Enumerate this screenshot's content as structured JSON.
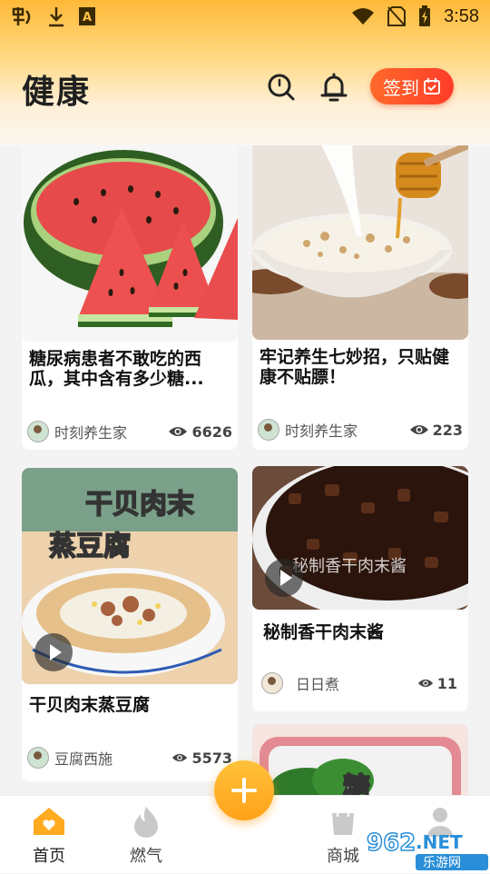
{
  "status_bar": {
    "time": "3:58",
    "left_icons": [
      "app-notification-icon",
      "download-icon",
      "a-box-icon"
    ],
    "right_icons": [
      "wifi-icon",
      "no-sim-icon",
      "battery-charging-icon"
    ]
  },
  "header": {
    "title": "健康",
    "search_icon": "search-icon",
    "bell_icon": "bell-icon",
    "signin_label": "签到"
  },
  "feed": {
    "cards": [
      {
        "title": "糖尿病患者不敢吃的西瓜，其中含有多少糖...",
        "author": "时刻养生家",
        "views": "6626",
        "has_video": false
      },
      {
        "title": "牢记养生七妙招，只贴健康不贴膘！",
        "author": "时刻养生家",
        "views": "223",
        "has_video": false
      },
      {
        "title": "干贝肉末蒸豆腐",
        "author": "豆腐西施",
        "views": "5573",
        "has_video": true,
        "overlay_text": [
          "干贝肉末",
          "蒸豆腐"
        ]
      },
      {
        "title": "秘制香干肉末酱",
        "author": "日日煮",
        "views": "11",
        "has_video": true,
        "overlay_text": [
          "秘制香干肉末酱"
        ]
      },
      {
        "overlay_text": [
          "糖"
        ]
      }
    ]
  },
  "bottom_nav": {
    "items": [
      {
        "label": "首页",
        "icon": "home-icon",
        "active": true
      },
      {
        "label": "燃气",
        "icon": "flame-icon",
        "active": false
      },
      {
        "label": "商城",
        "icon": "shopping-bag-icon",
        "active": false
      },
      {
        "label": "",
        "icon": "profile-icon",
        "active": false
      }
    ],
    "fab_icon": "plus-icon"
  },
  "watermark": {
    "text1": "962",
    "text2": ".NET",
    "text3": "乐游网"
  },
  "colors": {
    "accent": "#ffa81e",
    "signin": "#ff4a2a",
    "header_top": "#ffb938"
  }
}
